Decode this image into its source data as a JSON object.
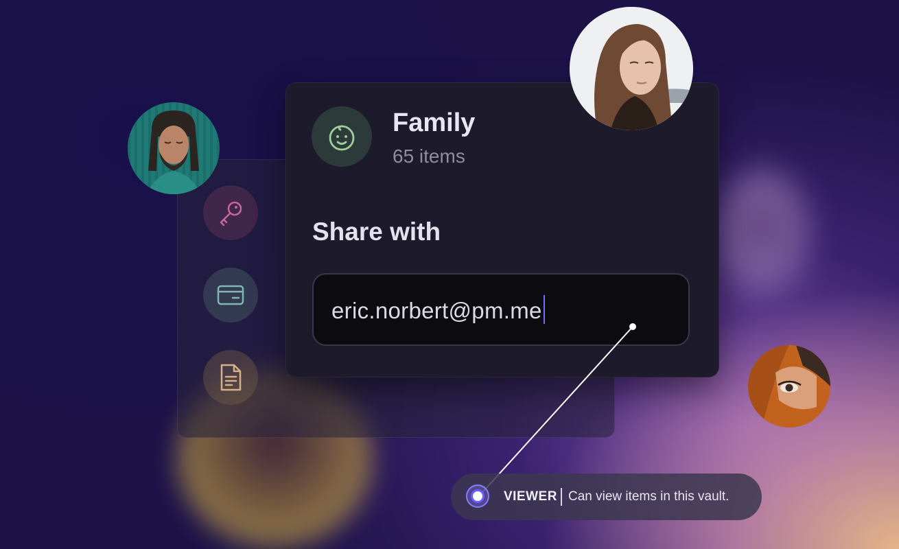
{
  "vault": {
    "name": "Family",
    "item_count": "65 items",
    "icon": "baby-face-icon"
  },
  "share": {
    "title": "Share with",
    "email_value": "eric.norbert@pm.me"
  },
  "side_items": [
    {
      "icon": "key-icon",
      "color": "#c46a9a"
    },
    {
      "icon": "credit-card-icon",
      "color": "#7fb8b0"
    },
    {
      "icon": "document-icon",
      "color": "#d6b08a"
    }
  ],
  "role": {
    "name": "VIEWER",
    "description": "Can view items in this vault."
  },
  "colors": {
    "background": "#1c1248",
    "accent": "#7b6cff",
    "card": "#1d1b2b"
  }
}
